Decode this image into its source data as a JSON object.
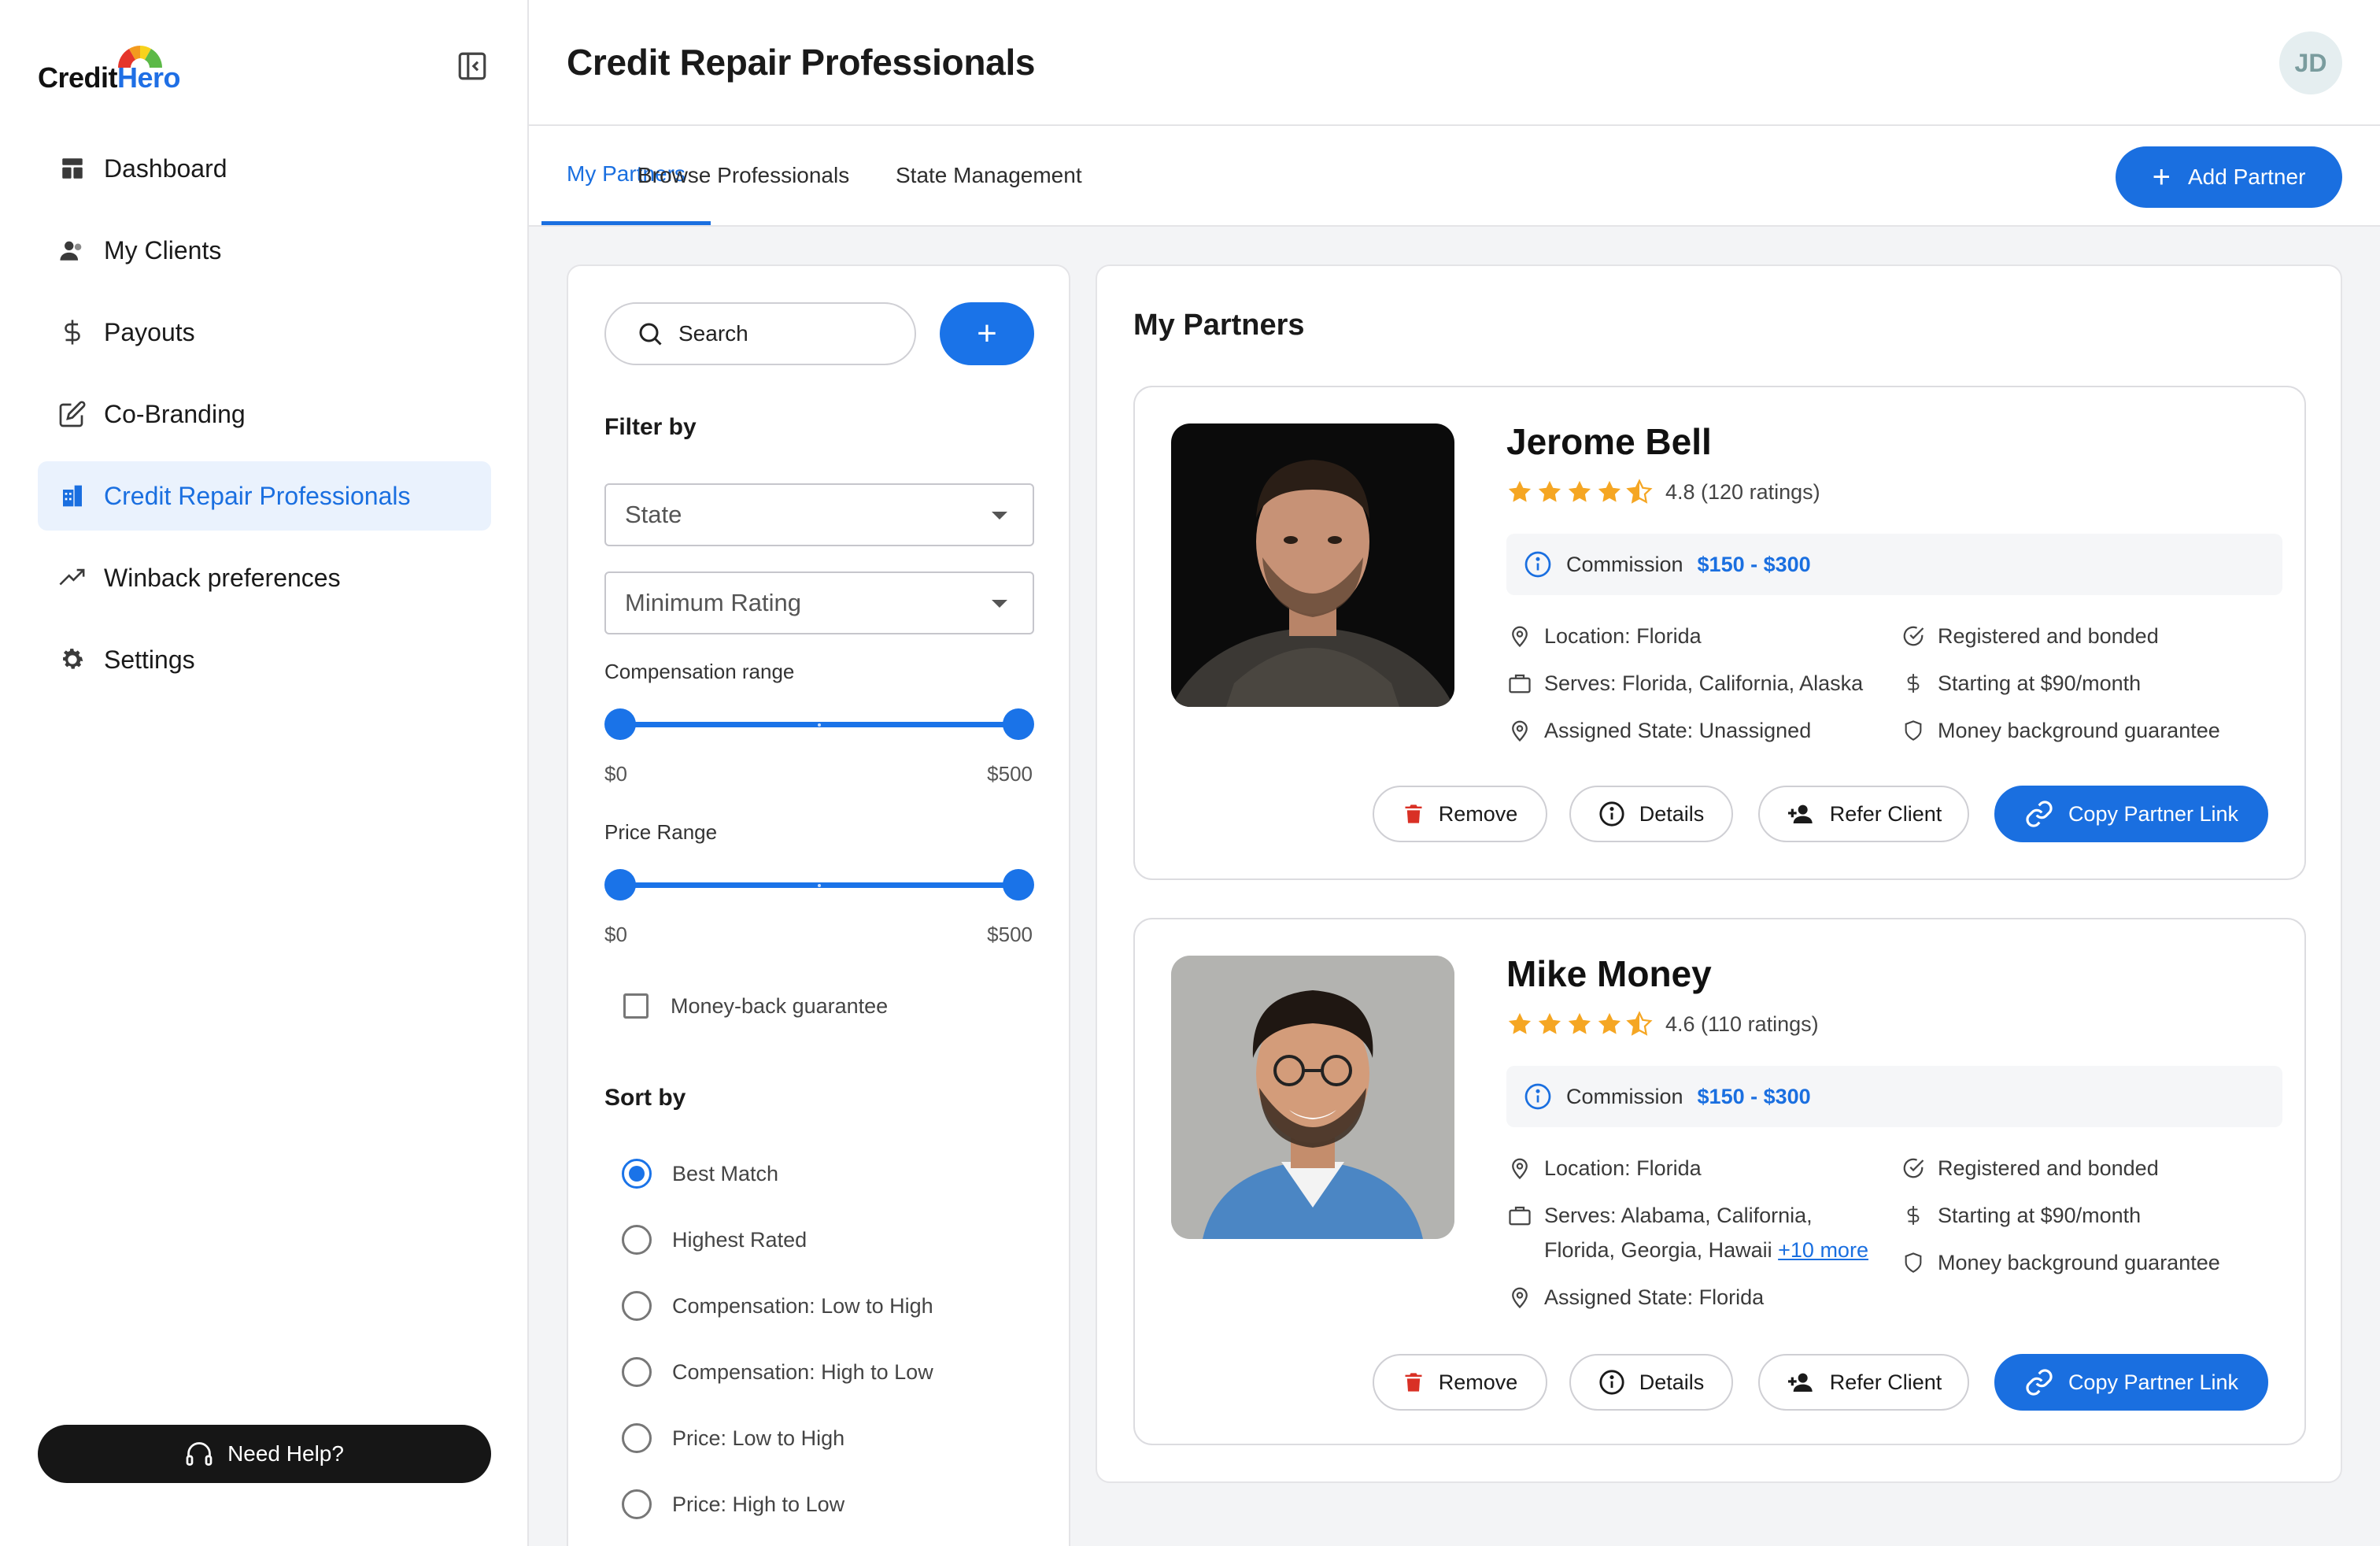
{
  "brand": {
    "logo_part1": "Credit",
    "logo_part2": "Hero",
    "accent": "#1a6fe0"
  },
  "sidebar": {
    "items": [
      {
        "label": "Dashboard",
        "icon": "dashboard-icon"
      },
      {
        "label": "My Clients",
        "icon": "clients-icon"
      },
      {
        "label": "Payouts",
        "icon": "dollar-icon"
      },
      {
        "label": "Co-Branding",
        "icon": "edit-icon"
      },
      {
        "label": "Credit Repair Professionals",
        "icon": "building-icon",
        "active": true
      },
      {
        "label": "Winback preferences",
        "icon": "trending-up-icon"
      },
      {
        "label": "Settings",
        "icon": "gear-icon"
      }
    ],
    "help_label": "Need Help?"
  },
  "header": {
    "title": "Credit Repair Professionals",
    "avatar_initials": "JD"
  },
  "tabs": [
    {
      "label": "My Partners",
      "active": true
    },
    {
      "label": "Browse Professionals"
    },
    {
      "label": "State Management"
    }
  ],
  "add_partner_label": "Add Partner",
  "filters": {
    "search_placeholder": "Search",
    "filter_by_label": "Filter by",
    "state_select": "State",
    "rating_select": "Minimum Rating",
    "compensation_label": "Compensation range",
    "compensation_min": "$0",
    "compensation_max": "$500",
    "price_label": "Price Range",
    "price_min": "$0",
    "price_max": "$500",
    "money_back_label": "Money-back guarantee",
    "sort_by_label": "Sort by",
    "sort_options": [
      {
        "label": "Best Match",
        "checked": true
      },
      {
        "label": "Highest Rated"
      },
      {
        "label": "Compensation: Low to High"
      },
      {
        "label": "Compensation: High to Low"
      },
      {
        "label": "Price: Low to High"
      },
      {
        "label": "Price: High to Low"
      }
    ]
  },
  "partners": {
    "title": "My Partners",
    "cards": [
      {
        "name": "Jerome Bell",
        "rating_text": "4.8 (120 ratings)",
        "stars": 4.5,
        "commission_label": "Commission",
        "commission_value": "$150 - $300",
        "location": "Location: Florida",
        "serves": "Serves: Florida, California, Alaska",
        "assigned_state": "Assigned State: Unassigned",
        "registered": "Registered and bonded",
        "starting": "Starting at $90/month",
        "guarantee": "Money background guarantee",
        "buttons": {
          "remove": "Remove",
          "details": "Details",
          "refer": "Refer Client",
          "copy": "Copy Partner Link"
        }
      },
      {
        "name": "Mike Money",
        "rating_text": "4.6 (110 ratings)",
        "stars": 4.5,
        "commission_label": "Commission",
        "commission_value": "$150 - $300",
        "location": "Location: Florida",
        "serves_line1": "Serves: Alabama, California,",
        "serves_line2": "Florida, Georgia, Hawaii",
        "serves_more": "+10 more",
        "assigned_state": "Assigned State: Florida",
        "registered": "Registered and bonded",
        "starting": "Starting at $90/month",
        "guarantee": "Money background guarantee",
        "buttons": {
          "remove": "Remove",
          "details": "Details",
          "refer": "Refer Client",
          "copy": "Copy Partner Link"
        }
      }
    ]
  }
}
